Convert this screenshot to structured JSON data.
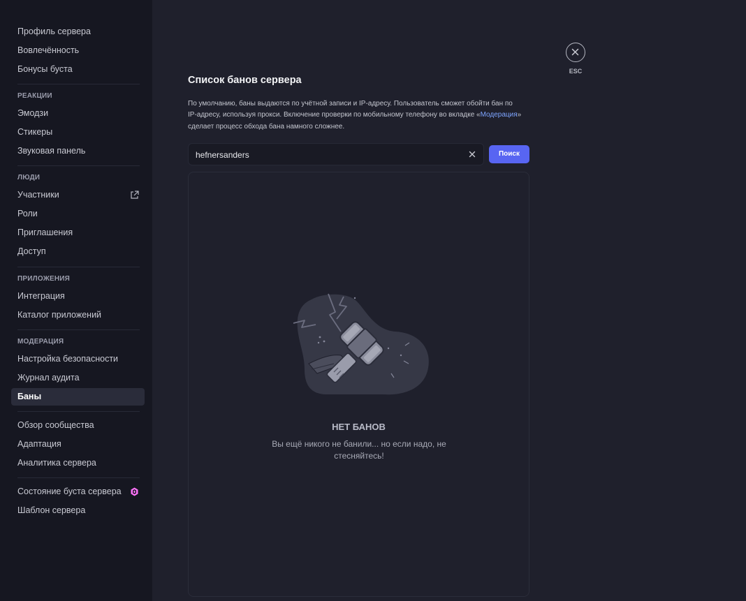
{
  "sidebar": {
    "items": [
      {
        "label": "Профиль сервера"
      },
      {
        "label": "Вовлечённость"
      },
      {
        "label": "Бонусы буста"
      }
    ],
    "sections": [
      {
        "heading": "РЕАКЦИИ",
        "items": [
          {
            "label": "Эмодзи"
          },
          {
            "label": "Стикеры"
          },
          {
            "label": "Звуковая панель"
          }
        ]
      },
      {
        "heading": "ЛЮДИ",
        "items": [
          {
            "label": "Участники"
          },
          {
            "label": "Роли"
          },
          {
            "label": "Приглашения"
          },
          {
            "label": "Доступ"
          }
        ]
      },
      {
        "heading": "ПРИЛОЖЕНИЯ",
        "items": [
          {
            "label": "Интеграция"
          },
          {
            "label": "Каталог приложений"
          }
        ]
      },
      {
        "heading": "МОДЕРАЦИЯ",
        "items": [
          {
            "label": "Настройка безопасности"
          },
          {
            "label": "Журнал аудита"
          },
          {
            "label": "Баны"
          }
        ]
      }
    ],
    "extra": [
      {
        "label": "Обзор сообщества"
      },
      {
        "label": "Адаптация"
      },
      {
        "label": "Аналитика сервера"
      }
    ],
    "bottom": [
      {
        "label": "Состояние буста сервера"
      },
      {
        "label": "Шаблон сервера"
      }
    ],
    "active_item": "Баны"
  },
  "main": {
    "title": "Список банов сервера",
    "desc_part1": "По умолчанию, баны выдаются по учётной записи и IP-адресу. Пользователь сможет обойти бан по IP-адресу, используя прокси. Включение проверки по мобильному телефону во вкладке «",
    "desc_link": "Модерация",
    "desc_part2": "» сделает процесс обхода бана намного сложнее.",
    "search_value": "hefnersanders",
    "search_button": "Поиск",
    "empty_title": "НЕТ БАНОВ",
    "empty_text": "Вы ещё никого не банили... но если надо, не стесняйтесь!"
  },
  "esc_label": "ESC",
  "colors": {
    "accent": "#5865f2",
    "link": "#7ea5ff",
    "boost": "#ff73fa"
  }
}
